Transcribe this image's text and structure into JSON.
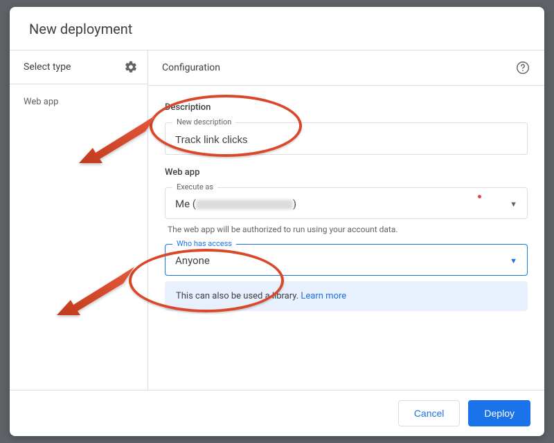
{
  "title": "New deployment",
  "left": {
    "header": "Select type",
    "items": [
      "Web app"
    ]
  },
  "right": {
    "header": "Configuration",
    "description_section": "Description",
    "new_description_label": "New description",
    "new_description_value": "Track link clicks",
    "webapp_section": "Web app",
    "execute_as_label": "Execute as",
    "execute_as_value_prefix": "Me (",
    "execute_as_value_suffix": ")",
    "execute_as_helper": "The web app will be authorized to run using your account data.",
    "who_label": "Who has access",
    "who_value": "Anyone",
    "info_text": "This can also be used a library. ",
    "info_link": "Learn more"
  },
  "footer": {
    "cancel": "Cancel",
    "deploy": "Deploy"
  }
}
